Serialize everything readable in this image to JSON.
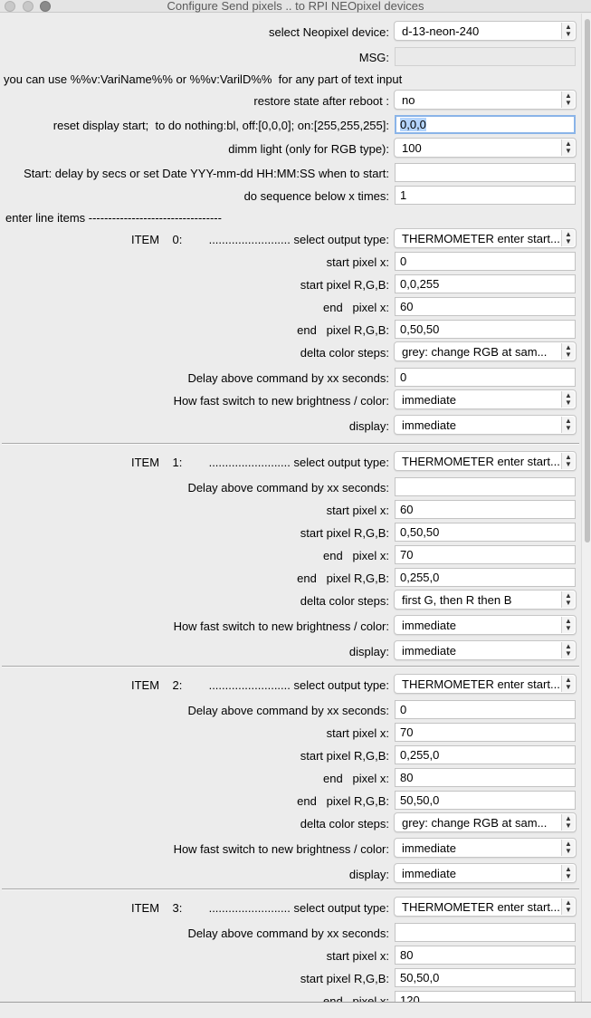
{
  "window": {
    "title": "Configure Send pixels ..  to  RPI NEOpixel devices"
  },
  "header": {
    "device_label": "select Neopixel device:",
    "device_value": "d-13-neon-240",
    "msg_label": "MSG:",
    "msg_value": "",
    "hint": "you can use %%v:VariName%% or %%v:VarilD%%  for any part of text input",
    "restore_label": "restore state after reboot :",
    "restore_value": "no",
    "reset_label": "reset display start;  to do nothing:bl, off:[0,0,0]; on:[255,255,255]:",
    "reset_value": "0,0,0",
    "dimm_label": "dimm light (only for RGB type):",
    "dimm_value": "100",
    "start_label": "Start: delay by secs or set Date YYY-mm-dd HH:MM:SS when to start:",
    "start_value": "",
    "repeat_label": "do sequence below x times:",
    "repeat_value": "1",
    "enter_items": "enter line items ----------------------------------"
  },
  "item_dots": "......................... select output type:",
  "items": [
    {
      "head": "ITEM    0:",
      "type": "THERMOMETER enter start...",
      "rows": [
        {
          "label": "start pixel x:",
          "value": "0",
          "kind": "input"
        },
        {
          "label": "start pixel R,G,B:",
          "value": "0,0,255",
          "kind": "input"
        },
        {
          "label": "end   pixel x:",
          "value": "60",
          "kind": "input"
        },
        {
          "label": "end   pixel R,G,B:",
          "value": "0,50,50",
          "kind": "input"
        },
        {
          "label": "delta color steps:",
          "value": "grey:  change RGB at sam...",
          "kind": "select"
        },
        {
          "label": "Delay above command by xx seconds:",
          "value": "0",
          "kind": "input"
        },
        {
          "label": "How fast switch to new brightness / color:",
          "value": "immediate",
          "kind": "select"
        },
        {
          "label": "display:",
          "value": "immediate",
          "kind": "select"
        }
      ]
    },
    {
      "head": "ITEM    1:",
      "type": "THERMOMETER enter start...",
      "rows": [
        {
          "label": "Delay above command by xx seconds:",
          "value": "",
          "kind": "input"
        },
        {
          "label": "start pixel x:",
          "value": "60",
          "kind": "input"
        },
        {
          "label": "start pixel R,G,B:",
          "value": "0,50,50",
          "kind": "input"
        },
        {
          "label": "end   pixel x:",
          "value": "70",
          "kind": "input"
        },
        {
          "label": "end   pixel R,G,B:",
          "value": "0,255,0",
          "kind": "input"
        },
        {
          "label": "delta color steps:",
          "value": "first G, then R then B",
          "kind": "select"
        },
        {
          "label": "How fast switch to new brightness / color:",
          "value": "immediate",
          "kind": "select"
        },
        {
          "label": "display:",
          "value": "immediate",
          "kind": "select"
        }
      ]
    },
    {
      "head": "ITEM    2:",
      "type": "THERMOMETER enter start...",
      "rows": [
        {
          "label": "Delay above command by xx seconds:",
          "value": "0",
          "kind": "input"
        },
        {
          "label": "start pixel x:",
          "value": "70",
          "kind": "input"
        },
        {
          "label": "start pixel R,G,B:",
          "value": "0,255,0",
          "kind": "input"
        },
        {
          "label": "end   pixel x:",
          "value": "80",
          "kind": "input"
        },
        {
          "label": "end   pixel R,G,B:",
          "value": "50,50,0",
          "kind": "input"
        },
        {
          "label": "delta color steps:",
          "value": "grey:  change RGB at sam...",
          "kind": "select"
        },
        {
          "label": "How fast switch to new brightness / color:",
          "value": "immediate",
          "kind": "select"
        },
        {
          "label": "display:",
          "value": "immediate",
          "kind": "select"
        }
      ]
    },
    {
      "head": "ITEM    3:",
      "type": "THERMOMETER enter start...",
      "rows": [
        {
          "label": "Delay above command by xx seconds:",
          "value": "",
          "kind": "input"
        },
        {
          "label": "start pixel x:",
          "value": "80",
          "kind": "input"
        },
        {
          "label": "start pixel R,G,B:",
          "value": "50,50,0",
          "kind": "input"
        },
        {
          "label": "end   pixel x:",
          "value": "120",
          "kind": "input"
        }
      ]
    }
  ]
}
